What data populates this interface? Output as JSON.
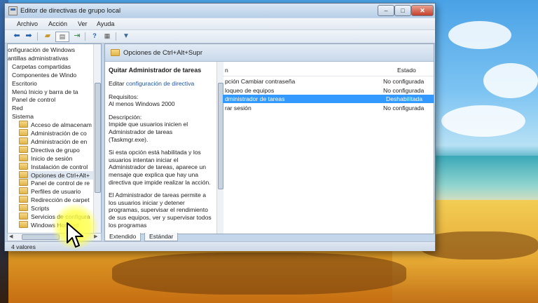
{
  "window": {
    "title": "Editor de directivas de grupo local",
    "buttons": {
      "minimize": "–",
      "maximize": "□",
      "close": "✕"
    }
  },
  "menubar": [
    "Archivo",
    "Acción",
    "Ver",
    "Ayuda"
  ],
  "toolbar_icons": [
    "back-arrow-icon",
    "forward-arrow-icon",
    "up-folder-icon",
    "show-tree-icon",
    "export-icon",
    "help-icon",
    "properties-icon",
    "filter-icon"
  ],
  "tree": {
    "items": [
      {
        "label": "onfiguración de Windows",
        "indent": 0,
        "folder": false
      },
      {
        "label": "antillas administrativas",
        "indent": 0,
        "folder": false
      },
      {
        "label": "Carpetas compartidas",
        "indent": 1,
        "folder": false
      },
      {
        "label": "Componentes de Windo",
        "indent": 1,
        "folder": false
      },
      {
        "label": "Escritorio",
        "indent": 1,
        "folder": false
      },
      {
        "label": "Menú Inicio y barra de ta",
        "indent": 1,
        "folder": false
      },
      {
        "label": "Panel de control",
        "indent": 1,
        "folder": false
      },
      {
        "label": "Red",
        "indent": 1,
        "folder": false
      },
      {
        "label": "Sistema",
        "indent": 1,
        "folder": false
      },
      {
        "label": "Acceso de almacenam",
        "indent": 2,
        "folder": true
      },
      {
        "label": "Administración de co",
        "indent": 2,
        "folder": true
      },
      {
        "label": "Administración de en",
        "indent": 2,
        "folder": true
      },
      {
        "label": "Directiva de grupo",
        "indent": 2,
        "folder": true
      },
      {
        "label": "Inicio de sesión",
        "indent": 2,
        "folder": true
      },
      {
        "label": "Instalación de control",
        "indent": 2,
        "folder": true
      },
      {
        "label": "Opciones de Ctrl+Alt+",
        "indent": 2,
        "folder": true,
        "selected": true
      },
      {
        "label": "Panel de control de re",
        "indent": 2,
        "folder": true
      },
      {
        "label": "Perfiles de usuario",
        "indent": 2,
        "folder": true
      },
      {
        "label": "Redirección de carpet",
        "indent": 2,
        "folder": true
      },
      {
        "label": "Scripts",
        "indent": 2,
        "folder": true
      },
      {
        "label": "Servicios de configura",
        "indent": 2,
        "folder": true
      },
      {
        "label": "Windows HotStart",
        "indent": 2,
        "folder": true
      }
    ]
  },
  "right": {
    "folder_title": "Opciones de Ctrl+Alt+Supr",
    "description": {
      "title": "Quitar Administrador de tareas",
      "edit_prefix": "Editar ",
      "edit_link": "configuración de directiva",
      "requirements_label": "Requisitos:",
      "requirements": "Al menos Windows 2000",
      "description_label": "Descripción:",
      "description_text": "Impide que usuarios inicien el Administrador de tareas (Taskmgr.exe).",
      "paragraph2": "Si esta opción está habilitada y los usuarios intentan iniciar el Administrador de tareas, aparece un mensaje que explica que hay una directiva que impide realizar la acción.",
      "paragraph3": "El Administrador de tareas permite a los usuarios iniciar y detener programas, supervisar el rendimiento de sus equipos, ver y supervisar todos los programas"
    },
    "list": {
      "columns": [
        "n",
        "Estado"
      ],
      "rows": [
        {
          "name": "pción Cambiar contraseña",
          "state": "No configurada"
        },
        {
          "name": "loqueo de equipos",
          "state": "No configurada"
        },
        {
          "name": "dministrador de tareas",
          "state": "Deshabilitada",
          "selected": true
        },
        {
          "name": "rar sesión",
          "state": "No configurada"
        }
      ]
    },
    "tabs": [
      "Extendido",
      "Estándar"
    ]
  },
  "status": "4 valores",
  "colors": {
    "selection": "#3399ff",
    "link": "#1a55a8",
    "titlebar": "#b8cfe8"
  }
}
